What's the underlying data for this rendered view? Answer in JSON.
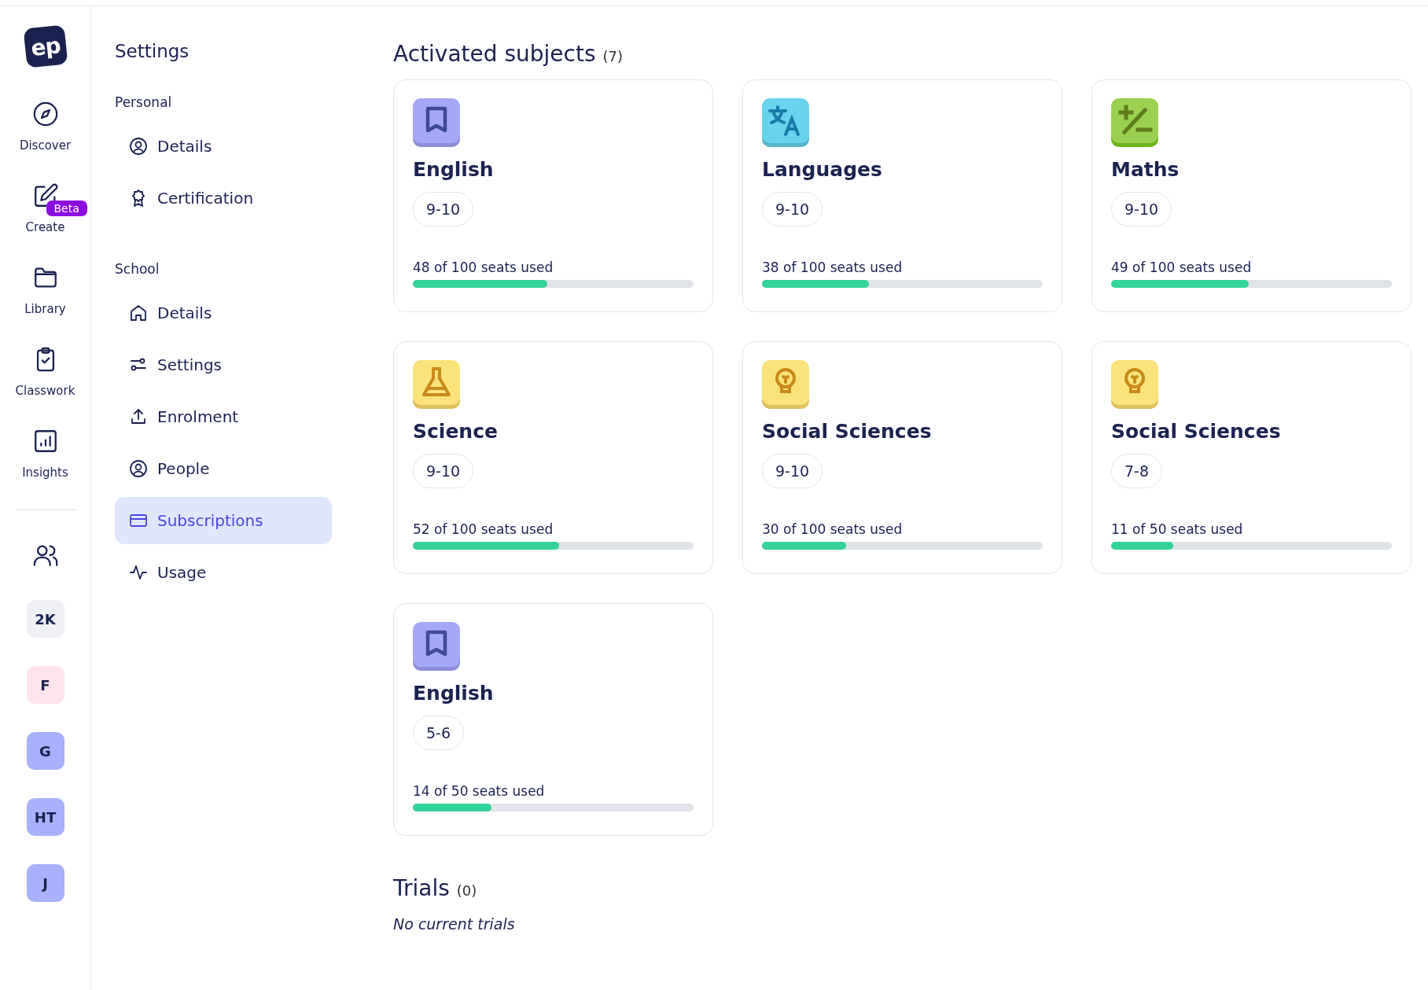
{
  "rail": {
    "items": [
      {
        "label": "Discover",
        "kind": "compass"
      },
      {
        "label": "Create",
        "kind": "pencil",
        "badge": "Beta"
      },
      {
        "label": "Library",
        "kind": "folder"
      },
      {
        "label": "Classwork",
        "kind": "clipboard"
      },
      {
        "label": "Insights",
        "kind": "chart"
      }
    ],
    "logo": "ep",
    "avatars": [
      {
        "initials": "2K",
        "color": "#eef0f5"
      },
      {
        "initials": "F",
        "color": "#fde4ea"
      },
      {
        "initials": "G",
        "color": "#a8b1fb"
      },
      {
        "initials": "HT",
        "color": "#a8b1fb"
      },
      {
        "initials": "J",
        "color": "#a8b1fb"
      }
    ]
  },
  "settings_nav": {
    "title": "Settings",
    "sections": [
      {
        "heading": "Personal",
        "items": [
          {
            "label": "Details",
            "kind": "user",
            "selected": false
          },
          {
            "label": "Certification",
            "kind": "award",
            "selected": false
          }
        ]
      },
      {
        "heading": "School",
        "items": [
          {
            "label": "Details",
            "kind": "home",
            "selected": false
          },
          {
            "label": "Settings",
            "kind": "sliders",
            "selected": false
          },
          {
            "label": "Enrolment",
            "kind": "upload",
            "selected": false
          },
          {
            "label": "People",
            "kind": "user",
            "selected": false
          },
          {
            "label": "Subscriptions",
            "kind": "card",
            "selected": true
          },
          {
            "label": "Usage",
            "kind": "pulse",
            "selected": false
          }
        ]
      }
    ]
  },
  "activated": {
    "title": "Activated subjects",
    "count": "(7)",
    "subjects": [
      {
        "name": "English",
        "kind": "bookmark",
        "color": "#a5a8f8",
        "years": "9-10",
        "seats": "48 of 100 seats used",
        "level": 0.48
      },
      {
        "name": "Languages",
        "kind": "translate",
        "color": "#68d3ec",
        "years": "9-10",
        "seats": "38 of 100 seats used",
        "level": 0.38
      },
      {
        "name": "Maths",
        "kind": "math",
        "color": "#9ad150",
        "years": "9-10",
        "seats": "49 of 100 seats used",
        "level": 0.49
      },
      {
        "name": "Science",
        "kind": "flask",
        "color": "#fbe27a",
        "years": "9-10",
        "seats": "52 of 100 seats used",
        "level": 0.52
      },
      {
        "name": "Social Sciences",
        "kind": "bulb",
        "color": "#fbe27a",
        "years": "9-10",
        "seats": "30 of 100 seats used",
        "level": 0.3
      },
      {
        "name": "Social Sciences",
        "kind": "bulb",
        "color": "#fbe27a",
        "years": "7-8",
        "seats": "11 of 50 seats used",
        "level": 0.22
      },
      {
        "name": "English",
        "kind": "bookmark",
        "color": "#a5a8f8",
        "years": "5-6",
        "seats": "14 of 50 seats used",
        "level": 0.28
      }
    ]
  },
  "trials": {
    "title": "Trials",
    "count": "(0)",
    "empty_text": "No current trials"
  }
}
